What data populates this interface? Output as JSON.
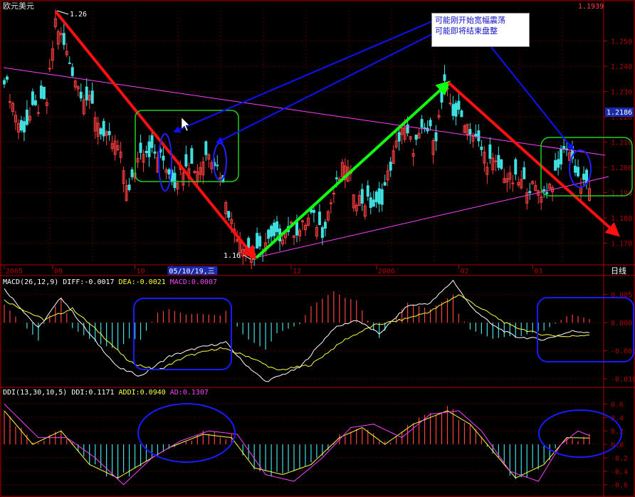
{
  "title": "欧元美元",
  "current_price": "1.1939",
  "price_badge": "1.2186",
  "high_label": "1.26",
  "low_label": "1.16",
  "period_label": "日线",
  "date_axis": [
    {
      "t": "2005",
      "i": 0
    },
    {
      "t": "09",
      "i": 17
    },
    {
      "t": "10",
      "i": 46
    },
    {
      "t": "05/10/19,三",
      "i": 59,
      "hl": true
    },
    {
      "t": "12",
      "i": 101
    },
    {
      "t": "2006",
      "i": 131
    },
    {
      "t": "02",
      "i": 160
    },
    {
      "t": "03",
      "i": 186
    }
  ],
  "note": [
    "可能刚开始宽幅震荡",
    "可能即将结束盘整"
  ],
  "macd": {
    "header": "MACD(26,12,9)",
    "diff": "DIFF:-0.0017",
    "dea": "DEA:-0.0021",
    "macd": "MACD:0.0007"
  },
  "ddi": {
    "header": "DDI(13,30,10,5)",
    "ddi": "DDI:0.1171",
    "addi": "ADDI:0.0940",
    "ad": "AD:0.1307"
  },
  "colors": {
    "up": "#ff4040",
    "down": "#40e0e0",
    "grid": "#800000",
    "axis": "#b00000",
    "magenta": "#ff40ff",
    "white": "#ffffff",
    "yellow": "#ffff40"
  },
  "chart_data": [
    {
      "type": "candlestick",
      "title": "欧元美元",
      "y_ticks": [
        "1.250",
        "1.240",
        "1.230",
        "1.220",
        "1.210",
        "1.200",
        "1.190",
        "1.180",
        "1.170"
      ],
      "ylim": [
        1.162,
        1.262
      ],
      "x_ticks": [
        "2005",
        "09",
        "10",
        "05/10/19,三",
        "12",
        "2006",
        "02",
        "03"
      ],
      "close_path": [
        [
          0,
          1.236
        ],
        [
          6,
          1.214
        ],
        [
          10,
          1.222
        ],
        [
          15,
          1.226
        ],
        [
          18,
          1.258
        ],
        [
          22,
          1.245
        ],
        [
          26,
          1.232
        ],
        [
          31,
          1.224
        ],
        [
          35,
          1.212
        ],
        [
          40,
          1.208
        ],
        [
          44,
          1.19
        ],
        [
          48,
          1.208
        ],
        [
          52,
          1.206
        ],
        [
          56,
          1.203
        ],
        [
          60,
          1.194
        ],
        [
          64,
          1.203
        ],
        [
          68,
          1.199
        ],
        [
          72,
          1.207
        ],
        [
          76,
          1.198
        ],
        [
          80,
          1.178
        ],
        [
          84,
          1.17
        ],
        [
          88,
          1.164
        ],
        [
          92,
          1.17
        ],
        [
          96,
          1.172
        ],
        [
          100,
          1.176
        ],
        [
          104,
          1.175
        ],
        [
          108,
          1.181
        ],
        [
          112,
          1.175
        ],
        [
          116,
          1.19
        ],
        [
          120,
          1.202
        ],
        [
          124,
          1.188
        ],
        [
          128,
          1.186
        ],
        [
          132,
          1.184
        ],
        [
          136,
          1.201
        ],
        [
          140,
          1.216
        ],
        [
          144,
          1.208
        ],
        [
          148,
          1.215
        ],
        [
          152,
          1.213
        ],
        [
          155,
          1.232
        ],
        [
          158,
          1.222
        ],
        [
          162,
          1.219
        ],
        [
          166,
          1.211
        ],
        [
          170,
          1.203
        ],
        [
          174,
          1.2
        ],
        [
          178,
          1.195
        ],
        [
          182,
          1.194
        ],
        [
          186,
          1.192
        ],
        [
          190,
          1.19
        ],
        [
          194,
          1.196
        ],
        [
          198,
          1.209
        ],
        [
          201,
          1.2
        ],
        [
          203,
          1.193
        ],
        [
          206,
          1.193
        ]
      ]
    },
    {
      "type": "line+bar",
      "title": "MACD(26,12,9)",
      "y_ticks": [
        "0.005",
        "0.000",
        "-0.005",
        "-0.010"
      ],
      "ylim": [
        -0.011,
        0.008
      ],
      "series": [
        {
          "name": "DIFF",
          "values": [
            [
              0,
              0.006
            ],
            [
              12,
              -0.001
            ],
            [
              20,
              0.0045
            ],
            [
              30,
              -0.002
            ],
            [
              40,
              -0.008
            ],
            [
              48,
              -0.0095
            ],
            [
              58,
              -0.006
            ],
            [
              68,
              -0.0045
            ],
            [
              78,
              -0.0035
            ],
            [
              84,
              -0.007
            ],
            [
              92,
              -0.0105
            ],
            [
              104,
              -0.008
            ],
            [
              116,
              -0.001
            ],
            [
              124,
              0.0005
            ],
            [
              132,
              -0.002
            ],
            [
              142,
              0.003
            ],
            [
              150,
              0.0035
            ],
            [
              158,
              0.0075
            ],
            [
              164,
              0.003
            ],
            [
              172,
              -0.0005
            ],
            [
              180,
              -0.0025
            ],
            [
              190,
              -0.003
            ],
            [
              200,
              -0.0015
            ],
            [
              206,
              -0.0017
            ]
          ]
        },
        {
          "name": "DEA",
          "values": [
            [
              0,
              0.004
            ],
            [
              14,
              0.0005
            ],
            [
              24,
              0.0025
            ],
            [
              34,
              -0.002
            ],
            [
              44,
              -0.007
            ],
            [
              54,
              -0.0085
            ],
            [
              64,
              -0.006
            ],
            [
              76,
              -0.0045
            ],
            [
              86,
              -0.006
            ],
            [
              96,
              -0.0085
            ],
            [
              108,
              -0.0075
            ],
            [
              120,
              -0.003
            ],
            [
              130,
              -0.0005
            ],
            [
              140,
              0.0005
            ],
            [
              150,
              0.002
            ],
            [
              160,
              0.005
            ],
            [
              168,
              0.0025
            ],
            [
              178,
              -0.0005
            ],
            [
              188,
              -0.002
            ],
            [
              198,
              -0.0025
            ],
            [
              206,
              -0.0021
            ]
          ]
        }
      ]
    },
    {
      "type": "line+bar",
      "title": "DDI(13,30,10,5)",
      "y_ticks": [
        "0.6",
        "0.4",
        "0.2",
        "0.0",
        "-0.2",
        "-0.4",
        "-0.6"
      ],
      "ylim": [
        -0.72,
        0.7
      ],
      "series": [
        {
          "name": "ADDI",
          "values": [
            [
              0,
              0.5
            ],
            [
              10,
              0.0
            ],
            [
              20,
              0.2
            ],
            [
              30,
              -0.3
            ],
            [
              40,
              -0.5
            ],
            [
              48,
              -0.3
            ],
            [
              58,
              -0.05
            ],
            [
              70,
              0.15
            ],
            [
              80,
              0.1
            ],
            [
              88,
              -0.35
            ],
            [
              98,
              -0.45
            ],
            [
              108,
              -0.3
            ],
            [
              118,
              0.1
            ],
            [
              126,
              0.25
            ],
            [
              134,
              0.0
            ],
            [
              144,
              0.3
            ],
            [
              156,
              0.5
            ],
            [
              164,
              0.3
            ],
            [
              172,
              -0.1
            ],
            [
              180,
              -0.5
            ],
            [
              190,
              -0.3
            ],
            [
              198,
              0.1
            ],
            [
              206,
              0.094
            ]
          ]
        },
        {
          "name": "AD",
          "values": [
            [
              0,
              0.6
            ],
            [
              12,
              0.1
            ],
            [
              22,
              0.1
            ],
            [
              32,
              -0.2
            ],
            [
              42,
              -0.6
            ],
            [
              52,
              -0.2
            ],
            [
              62,
              0.05
            ],
            [
              72,
              0.2
            ],
            [
              82,
              0.15
            ],
            [
              92,
              -0.45
            ],
            [
              102,
              -0.55
            ],
            [
              112,
              -0.2
            ],
            [
              122,
              0.25
            ],
            [
              130,
              0.3
            ],
            [
              140,
              0.1
            ],
            [
              150,
              0.45
            ],
            [
              160,
              0.5
            ],
            [
              168,
              0.2
            ],
            [
              178,
              -0.4
            ],
            [
              188,
              -0.55
            ],
            [
              196,
              0.0
            ],
            [
              202,
              0.2
            ],
            [
              206,
              0.1307
            ]
          ]
        }
      ]
    }
  ]
}
